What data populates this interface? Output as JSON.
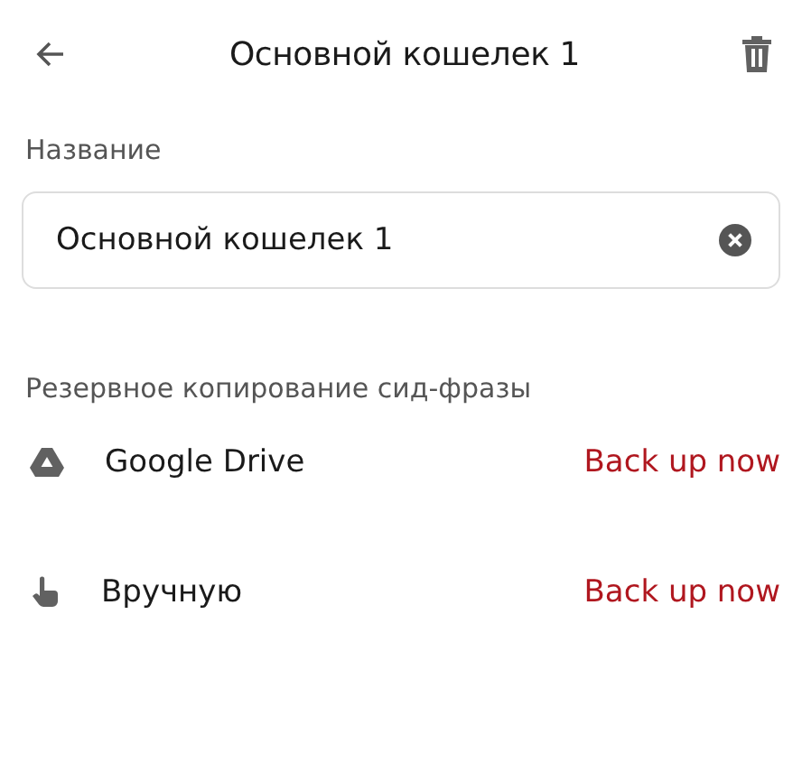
{
  "header": {
    "title": "Основной кошелек 1"
  },
  "name_field": {
    "label": "Название",
    "value": "Основной кошелек 1"
  },
  "backup": {
    "label": "Резервное копирование сид-фразы",
    "options": [
      {
        "kind": "drive",
        "name": "Google Drive",
        "action": "Back up now"
      },
      {
        "kind": "manual",
        "name": "Вручную",
        "action": "Back up now"
      }
    ]
  }
}
